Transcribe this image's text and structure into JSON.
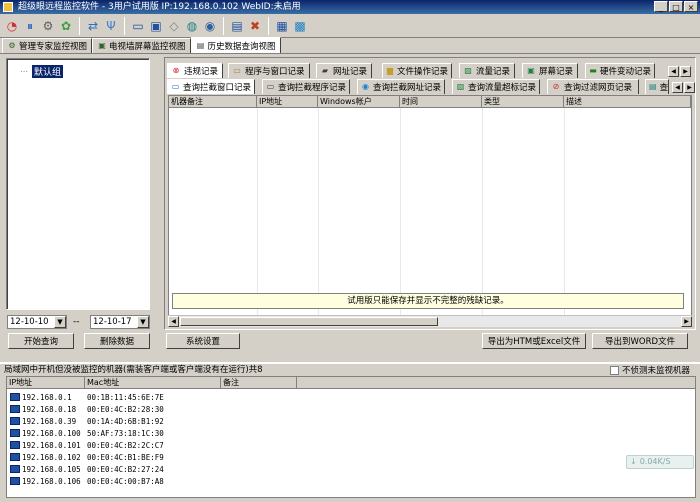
{
  "window": {
    "title": "超级眼远程监控软件 - 3用户试用版 IP:192.168.0.102 WebID:未启用",
    "controls": [
      "_",
      "□",
      "×"
    ]
  },
  "toolbar": {
    "icons": [
      "chart-pie-icon",
      "pause-icon",
      "settings-icon",
      "tool-icon",
      "network-icon",
      "wand-icon",
      "monitor-icon",
      "screen-icon",
      "shield-icon",
      "filter-icon",
      "disc-icon",
      "help-icon",
      "report-icon",
      "keyboard-icon",
      "window-icon"
    ]
  },
  "view_tabs": [
    {
      "label": "管理专家监控视图",
      "active": false
    },
    {
      "label": "电视墙屏幕监控视图",
      "active": false
    },
    {
      "label": "历史数据查询视图",
      "active": true
    }
  ],
  "tree": {
    "root_label": "默认组"
  },
  "date_range": {
    "from": "12-10-10",
    "separator": "--",
    "to": "12-10-17"
  },
  "left_buttons": {
    "query": "开始查询",
    "delete": "删除数据"
  },
  "record_tabs_row1": [
    {
      "label": "违规记录",
      "active": true
    },
    {
      "label": "程序与窗口记录"
    },
    {
      "label": "网址记录"
    },
    {
      "label": "文件操作记录"
    },
    {
      "label": "流量记录"
    },
    {
      "label": "屏幕记录"
    },
    {
      "label": "硬件变动记录"
    }
  ],
  "record_tabs_row2": [
    {
      "label": "查询拦截窗口记录",
      "active": true
    },
    {
      "label": "查询拦截程序记录"
    },
    {
      "label": "查询拦截网址记录"
    },
    {
      "label": "查询流量超标记录"
    },
    {
      "label": "查询过滤网页记录"
    },
    {
      "label": "查"
    }
  ],
  "grid": {
    "columns": [
      "机器备注",
      "IP地址",
      "Windows帐户",
      "时间",
      "类型",
      "描述"
    ]
  },
  "notice": "试用版只能保存并显示不完整的残缺记录。",
  "bottom_buttons": {
    "settings": "系统设置",
    "export_excel": "导出为HTM或Excel文件",
    "export_word": "导出到WORD文件"
  },
  "unmonitored": {
    "header": "局域网中开机但没被监控的机器(需装客户端或客户端没有在运行)共8",
    "checkbox_label": "不侦测未监视机器",
    "columns": [
      "IP地址",
      "Mac地址",
      "备注"
    ],
    "rows": [
      {
        "ip": "192.168.0.1",
        "mac": "00:1B:11:45:6E:7E"
      },
      {
        "ip": "192.168.0.18",
        "mac": "00:E0:4C:B2:28:30"
      },
      {
        "ip": "192.168.0.39",
        "mac": "00:1A:4D:6B:B1:92"
      },
      {
        "ip": "192.168.0.100",
        "mac": "50:AF:73:18:1C:30"
      },
      {
        "ip": "192.168.0.101",
        "mac": "00:E0:4C:B2:2C:C7"
      },
      {
        "ip": "192.168.0.102",
        "mac": "00:E0:4C:B1:BE:F9"
      },
      {
        "ip": "192.168.0.105",
        "mac": "00:E0:4C:B2:27:24"
      },
      {
        "ip": "192.168.0.106",
        "mac": "00:E0:4C:00:B7:A8"
      }
    ]
  },
  "speed": "0.04K/S"
}
